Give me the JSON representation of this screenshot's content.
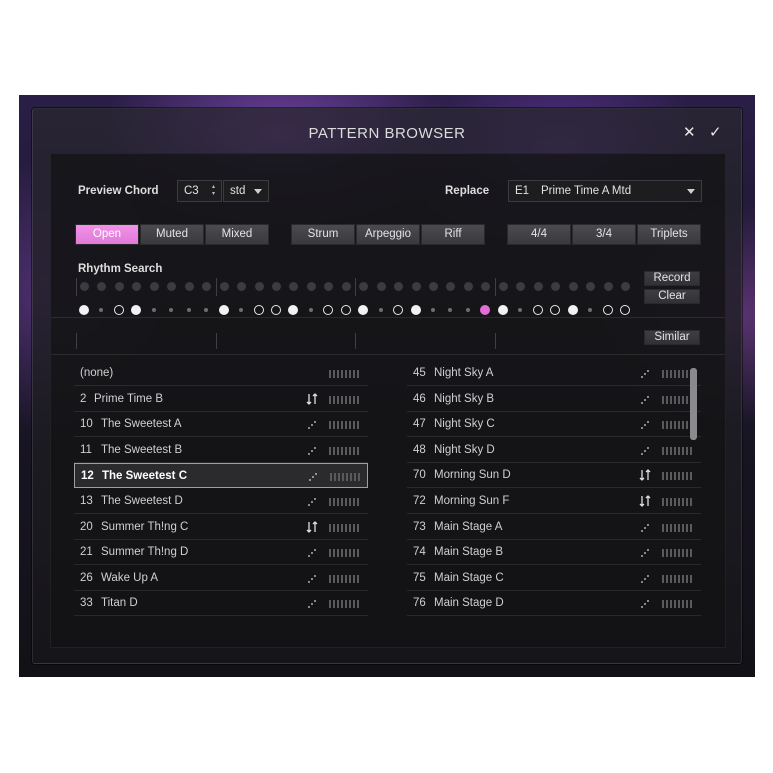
{
  "dialog": {
    "title": "PATTERN BROWSER",
    "close_glyph": "✕",
    "confirm_glyph": "✓"
  },
  "preview": {
    "label": "Preview Chord",
    "chord": "C3",
    "type": "std",
    "spinner_glyph": "▴▾"
  },
  "replace": {
    "label": "Replace",
    "key": "E1",
    "pattern": "Prime Time A Mtd"
  },
  "play_mode": [
    "Open",
    "Muted",
    "Mixed"
  ],
  "play_mode_active": "Open",
  "style": [
    "Strum",
    "Arpeggio",
    "Riff"
  ],
  "meter": [
    "4/4",
    "3/4",
    "Triplets"
  ],
  "rhythm": {
    "label": "Rhythm Search",
    "record_label": "Record",
    "clear_label": "Clear",
    "similar_label": "Similar"
  },
  "pattern_steps": [
    "W",
    "s",
    "O",
    "W",
    "s",
    "s",
    "s",
    "s",
    "W",
    "s",
    "O",
    "O",
    "W",
    "s",
    "O",
    "O",
    "W",
    "s",
    "O",
    "W",
    "s",
    "s",
    "s",
    "P",
    "W",
    "s",
    "O",
    "O",
    "W",
    "s",
    "O",
    "O"
  ],
  "colors": {
    "accent_pink": "#e884de",
    "step_pink": "#e06ed6"
  },
  "list_left": [
    {
      "num": "",
      "name": "(none)",
      "icon": ""
    },
    {
      "num": "2",
      "name": "Prime Time B",
      "icon": "updown-arrows-icon"
    },
    {
      "num": "10",
      "name": "The Sweetest A",
      "icon": "strum-icon"
    },
    {
      "num": "11",
      "name": "The Sweetest B",
      "icon": "strum-icon"
    },
    {
      "num": "12",
      "name": "The Sweetest C",
      "icon": "strum-icon",
      "selected": true
    },
    {
      "num": "13",
      "name": "The Sweetest D",
      "icon": "strum-icon"
    },
    {
      "num": "20",
      "name": "Summer Th!ng C",
      "icon": "updown-arrows-icon"
    },
    {
      "num": "21",
      "name": "Summer Th!ng D",
      "icon": "strum-icon"
    },
    {
      "num": "26",
      "name": "Wake Up A",
      "icon": "strum-icon"
    },
    {
      "num": "33",
      "name": "Titan D",
      "icon": "strum-icon"
    }
  ],
  "list_right": [
    {
      "num": "45",
      "name": "Night Sky A",
      "icon": "strum-icon"
    },
    {
      "num": "46",
      "name": "Night Sky B",
      "icon": "strum-icon"
    },
    {
      "num": "47",
      "name": "Night Sky C",
      "icon": "strum-icon"
    },
    {
      "num": "48",
      "name": "Night Sky D",
      "icon": "strum-icon"
    },
    {
      "num": "70",
      "name": "Morning Sun D",
      "icon": "updown-arrows-icon"
    },
    {
      "num": "72",
      "name": "Morning Sun F",
      "icon": "updown-arrows-icon"
    },
    {
      "num": "73",
      "name": "Main Stage A",
      "icon": "strum-icon"
    },
    {
      "num": "74",
      "name": "Main Stage B",
      "icon": "strum-icon"
    },
    {
      "num": "75",
      "name": "Main Stage C",
      "icon": "strum-icon"
    },
    {
      "num": "76",
      "name": "Main Stage D",
      "icon": "strum-icon"
    }
  ]
}
